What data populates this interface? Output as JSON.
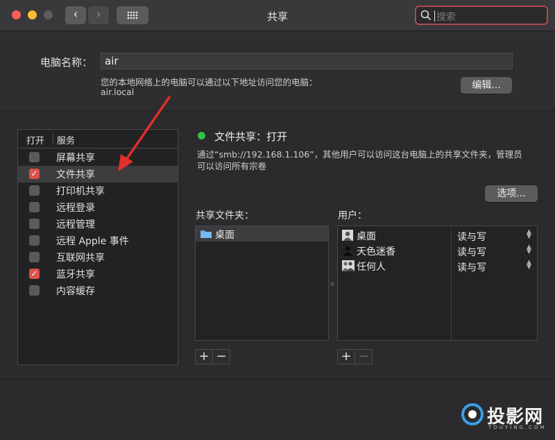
{
  "window": {
    "title": "共享"
  },
  "search": {
    "placeholder": "搜索"
  },
  "computer_name": {
    "label": "电脑名称：",
    "value": "air",
    "description": "您的本地网络上的电脑可以通过以下地址访问您的电脑：",
    "address": "air.local",
    "edit_label": "编辑..."
  },
  "services": {
    "header_on": "打开",
    "header_service": "服务",
    "items": [
      {
        "label": "屏幕共享",
        "checked": false,
        "selected": false
      },
      {
        "label": "文件共享",
        "checked": true,
        "selected": true
      },
      {
        "label": "打印机共享",
        "checked": false,
        "selected": false
      },
      {
        "label": "远程登录",
        "checked": false,
        "selected": false
      },
      {
        "label": "远程管理",
        "checked": false,
        "selected": false
      },
      {
        "label": "远程 Apple 事件",
        "checked": false,
        "selected": false
      },
      {
        "label": "互联网共享",
        "checked": false,
        "selected": false
      },
      {
        "label": "蓝牙共享",
        "checked": true,
        "selected": false
      },
      {
        "label": "内容缓存",
        "checked": false,
        "selected": false
      }
    ]
  },
  "detail": {
    "status": "文件共享：打开",
    "status_color": "#31c443",
    "description_line1": "通过“smb://192.168.1.106”，其他用户可以访问这台电脑上的共享文件夹，管理员",
    "description_line2": "可以访问所有宗卷",
    "options_label": "选项...",
    "shared_folders_label": "共享文件夹：",
    "users_label": "用户：",
    "folders": [
      {
        "name": "桌面",
        "icon": "folder-icon"
      }
    ],
    "users": [
      {
        "name": "桌面",
        "permission": "读与写",
        "icon": "user-icon"
      },
      {
        "name": "天色迷香",
        "permission": "读与写",
        "icon": "user-silhouette-icon"
      },
      {
        "name": "任何人",
        "permission": "读与写",
        "icon": "group-icon"
      }
    ],
    "add_label": "+",
    "remove_label": "−"
  },
  "watermark": {
    "text": "投影网",
    "sub": "TOUYING.COM"
  },
  "colors": {
    "accent_red": "#d9524b",
    "search_border": "#b04a52"
  }
}
